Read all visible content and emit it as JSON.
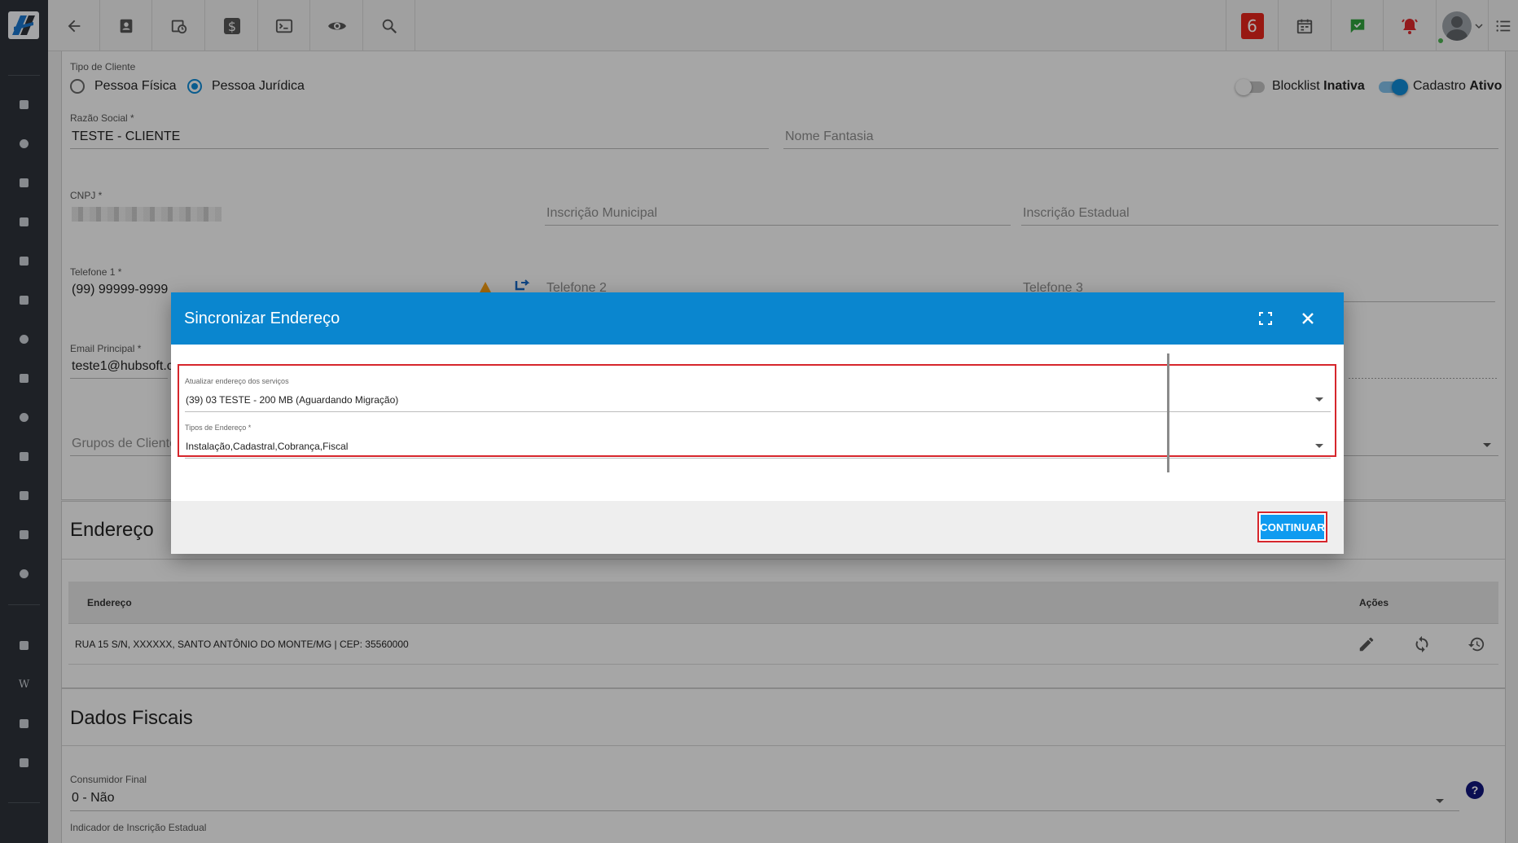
{
  "topbar": {
    "notification_count": "6"
  },
  "form": {
    "tipo_cliente_label": "Tipo de Cliente",
    "pessoa_fisica": "Pessoa Física",
    "pessoa_juridica": "Pessoa Jurídica",
    "blocklist_label": "Blocklist",
    "blocklist_state": "Inativa",
    "cadastro_label": "Cadastro",
    "cadastro_state": "Ativo",
    "razao_social_label": "Razão Social *",
    "razao_social_value": "TESTE - CLIENTE",
    "nome_fantasia_placeholder": "Nome Fantasia",
    "cnpj_label": "CNPJ *",
    "inscricao_municipal_placeholder": "Inscrição Municipal",
    "inscricao_estadual_placeholder": "Inscrição Estadual",
    "telefone1_label": "Telefone 1 *",
    "telefone1_value": "(99) 99999-9999",
    "telefone2_placeholder": "Telefone 2",
    "telefone3_placeholder": "Telefone 3",
    "email_label": "Email Principal *",
    "email_value": "teste1@hubsoft.c",
    "grupos_placeholder": "Grupos de Cliente"
  },
  "endereco": {
    "title": "Endereço",
    "col_endereco": "Endereço",
    "col_acoes": "Ações",
    "row_address": "RUA 15 S/N, XXXXXX, SANTO ANTÔNIO DO MONTE/MG | CEP: 35560000"
  },
  "dados_fiscais": {
    "title": "Dados Fiscais",
    "consumidor_label": "Consumidor Final",
    "consumidor_value": "0 - Não",
    "indicador_label": "Indicador de Inscrição Estadual"
  },
  "modal": {
    "title": "Sincronizar Endereço",
    "field1_label": "Atualizar endereço dos serviços",
    "field1_value": "(39) 03 TESTE - 200 MB (Aguardando Migração)",
    "field2_label": "Tipos de Endereço *",
    "field2_value": "Instalação,Cadastral,Cobrança,Fiscal",
    "continue_label": "CONTINUAR"
  },
  "colors": {
    "modal_header": "#0a86cf",
    "primary_button": "#0f9bf0",
    "highlight": "#d6262c"
  },
  "icons": [
    "back-arrow-icon",
    "contact-card-icon",
    "calendar-clock-icon",
    "dollar-icon",
    "terminal-icon",
    "eye-icon",
    "search-icon",
    "calendar-list-icon",
    "chat-check-icon",
    "alarm-bell-icon",
    "menu-list-icon",
    "fullscreen-icon",
    "close-icon",
    "pencil-icon",
    "sync-icon",
    "history-icon",
    "help-icon"
  ]
}
